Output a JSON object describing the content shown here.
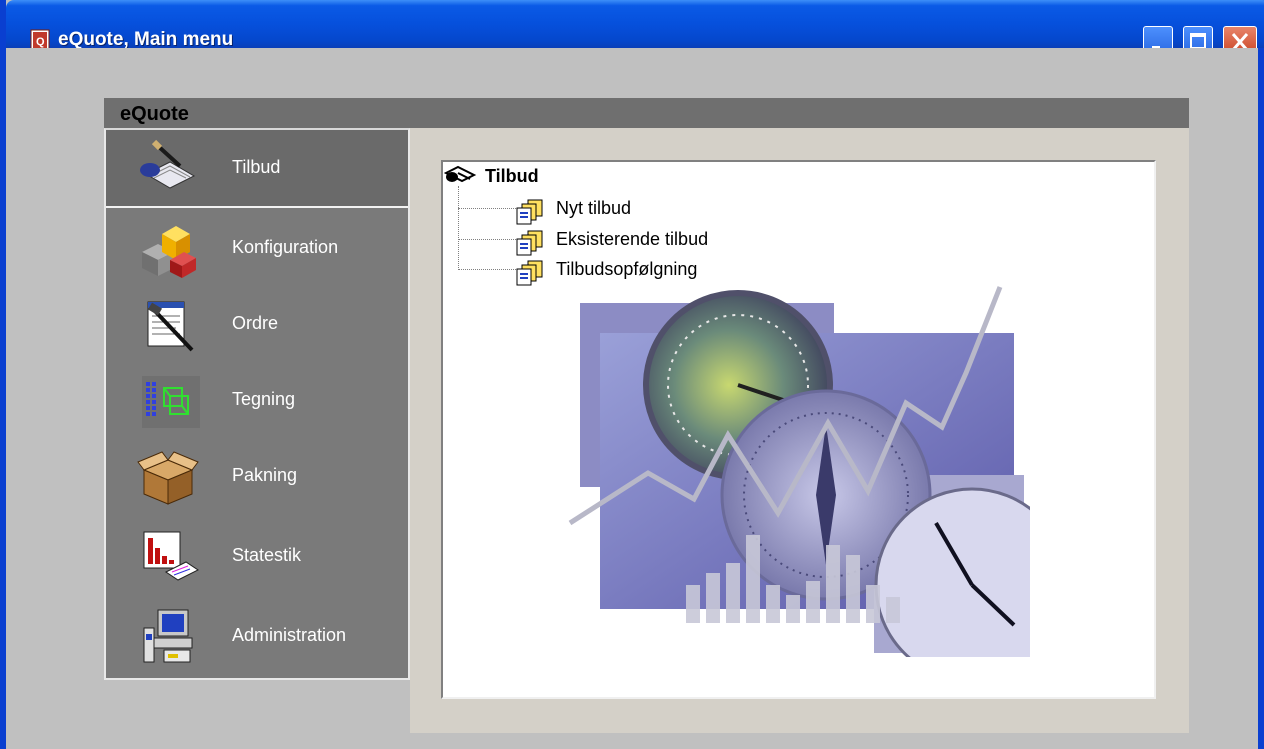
{
  "window": {
    "title": "eQuote, Main menu",
    "controls": [
      "minimize-button",
      "maximize-button",
      "close-button"
    ]
  },
  "panel": {
    "title": "eQuote"
  },
  "nav": {
    "items": [
      {
        "label": "Tilbud",
        "icon": "quote-pen-icon",
        "active": true
      },
      {
        "label": "Konfiguration",
        "icon": "blocks-icon",
        "active": false
      },
      {
        "label": "Ordre",
        "icon": "order-form-icon",
        "active": false
      },
      {
        "label": "Tegning",
        "icon": "drawing-icon",
        "active": false
      },
      {
        "label": "Pakning",
        "icon": "box-icon",
        "active": false
      },
      {
        "label": "Statestik",
        "icon": "statistics-chart-icon",
        "active": false
      },
      {
        "label": "Administration",
        "icon": "admin-computer-icon",
        "active": false
      }
    ]
  },
  "tree": {
    "root": {
      "label": "Tilbud",
      "icon": "tilbud-tree-icon"
    },
    "children": [
      {
        "label": "Nyt tilbud",
        "icon": "document-stack-icon"
      },
      {
        "label": "Eksisterende tilbud",
        "icon": "document-stack-icon"
      },
      {
        "label": "Tilbudsopfølgning",
        "icon": "document-stack-icon"
      }
    ]
  },
  "colors": {
    "titlebar": "#0650dc",
    "panel_header": "#6f6f6f",
    "nav_background": "#7a7a7a",
    "content_background": "#d4d0c8",
    "client_background": "#c0c0c0"
  }
}
